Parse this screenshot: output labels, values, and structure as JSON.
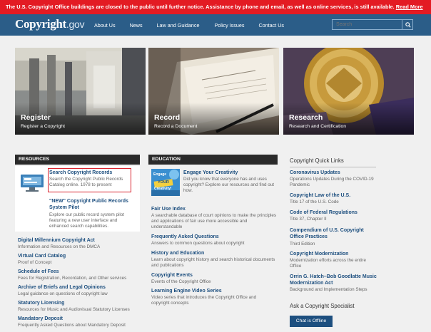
{
  "alert": {
    "text": "The U.S. Copyright Office buildings are closed to the public until further notice. Assistance by phone and email, as well as online services, is still available.",
    "link": "Read More"
  },
  "nav": {
    "logo_main": "Copyright",
    "logo_suffix": ".gov",
    "links": [
      "About Us",
      "News",
      "Law and Guidance",
      "Policy Issues",
      "Contact Us"
    ],
    "search_placeholder": "Search"
  },
  "hero": [
    {
      "title": "Register",
      "sub": "Register a Copyright"
    },
    {
      "title": "Record",
      "sub": "Record a Document"
    },
    {
      "title": "Research",
      "sub": "Research and Certification"
    }
  ],
  "resources": {
    "heading": "RESOURCES",
    "card": [
      {
        "title": "Search Copyright Records",
        "desc": "Search the Copyright Public Records Catalog online. 1978 to present"
      },
      {
        "title": "\"NEW\" Copyright Public Records System Pilot",
        "desc": "Explore our public record system pilot featuring a new user interface and enhanced search capabilities."
      }
    ],
    "items": [
      {
        "title": "Digital Millennium Copyright Act",
        "desc": "Information and Resources on the DMCA"
      },
      {
        "title": "Virtual Card Catalog",
        "desc": "Proof of Concept"
      },
      {
        "title": "Schedule of Fees",
        "desc": "Fees for Registration, Recordation, and Other services"
      },
      {
        "title": "Archive of Briefs and Legal Opinions",
        "desc": "Legal guidance on questions of copyright law"
      },
      {
        "title": "Statutory Licensing",
        "desc": "Resources for Music and Audiovisual Statutory Licenses"
      },
      {
        "title": "Mandatory Deposit",
        "desc": "Frequently Asked Questions about Mandatory Deposit"
      }
    ]
  },
  "education": {
    "heading": "EDUCATION",
    "feature": {
      "title": "Engage Your Creativity",
      "desc": "Did you know that everyone has and uses copyright? Explore our resources and find out how.",
      "thumb_text1": "Engage",
      "thumb_text2": "YOUR",
      "thumb_text3": "Creativity!"
    },
    "items": [
      {
        "title": "Fair Use Index",
        "desc": "A searchable database of court opinions to make the principles and applications of fair use more accessible and understandable"
      },
      {
        "title": "Frequently Asked Questions",
        "desc": "Answers to common questions about copyright"
      },
      {
        "title": "History and Education",
        "desc": "Learn about copyright history and search historical documents and publications"
      },
      {
        "title": "Copyright Events",
        "desc": "Events of the Copyright Office"
      },
      {
        "title": "Learning Engine Video Series",
        "desc": "Video series that introduces the Copyright Office and copyright concepts"
      }
    ]
  },
  "quicklinks": {
    "heading": "Copyright Quick Links",
    "items": [
      {
        "title": "Coronavirus Updates",
        "desc": "Operations Updates During the COVID-19 Pandemic"
      },
      {
        "title": "Copyright Law of the U.S.",
        "desc": "Title 17 of the U.S. Code"
      },
      {
        "title": "Code of Federal Regulations",
        "desc": "Title 37, Chapter II"
      },
      {
        "title": "Compendium of U.S. Copyright Office Practices",
        "desc": "Third Edition"
      },
      {
        "title": "Copyright Modernization",
        "desc": "Modernization efforts across the entire Office"
      },
      {
        "title": "Orrin G. Hatch–Bob Goodlatte Music Modernization Act",
        "desc": "Background and Implementation Steps"
      }
    ],
    "specialist_heading": "Ask a Copyright Specialist",
    "chat_label": "Chat is Offline"
  },
  "colors": {
    "nav": "#2b5d88",
    "alert": "#e31b23",
    "link": "#1d4f7f",
    "header_dark": "#2a2a2a"
  }
}
